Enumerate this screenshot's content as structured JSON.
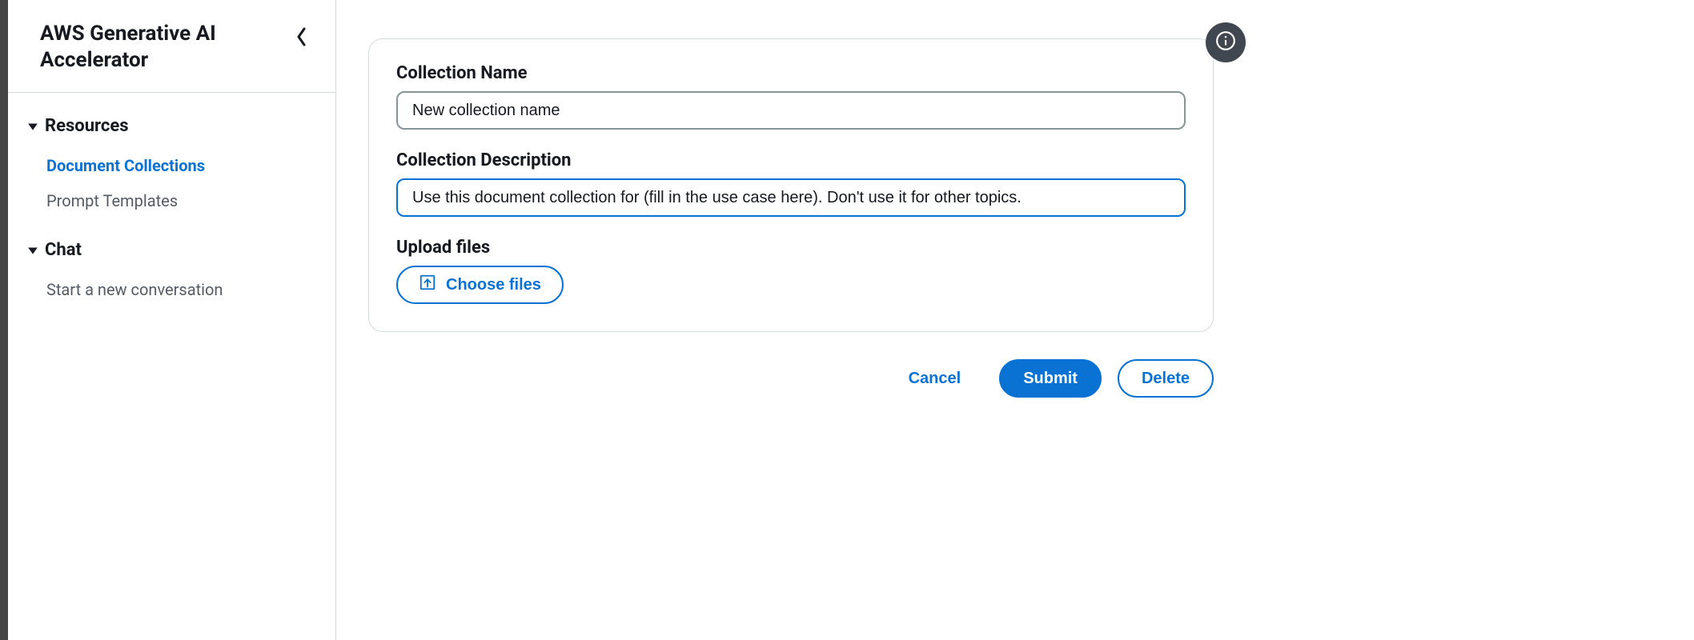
{
  "sidebar": {
    "title": "AWS Generative AI Accelerator",
    "groups": [
      {
        "label": "Resources",
        "items": [
          {
            "label": "Document Collections",
            "active": true
          },
          {
            "label": "Prompt Templates",
            "active": false
          }
        ]
      },
      {
        "label": "Chat",
        "items": [
          {
            "label": "Start a new conversation",
            "active": false
          }
        ]
      }
    ]
  },
  "form": {
    "collection_name_label": "Collection Name",
    "collection_name_value": "New collection name",
    "collection_desc_label": "Collection Description",
    "collection_desc_value": "Use this document collection for (fill in the use case here). Don't use it for other topics.",
    "upload_label": "Upload files",
    "choose_files_label": "Choose files"
  },
  "actions": {
    "cancel": "Cancel",
    "submit": "Submit",
    "delete": "Delete"
  },
  "icons": {
    "collapse": "chevron-left-icon",
    "caret": "caret-down-icon",
    "upload": "upload-icon",
    "info": "info-icon"
  }
}
